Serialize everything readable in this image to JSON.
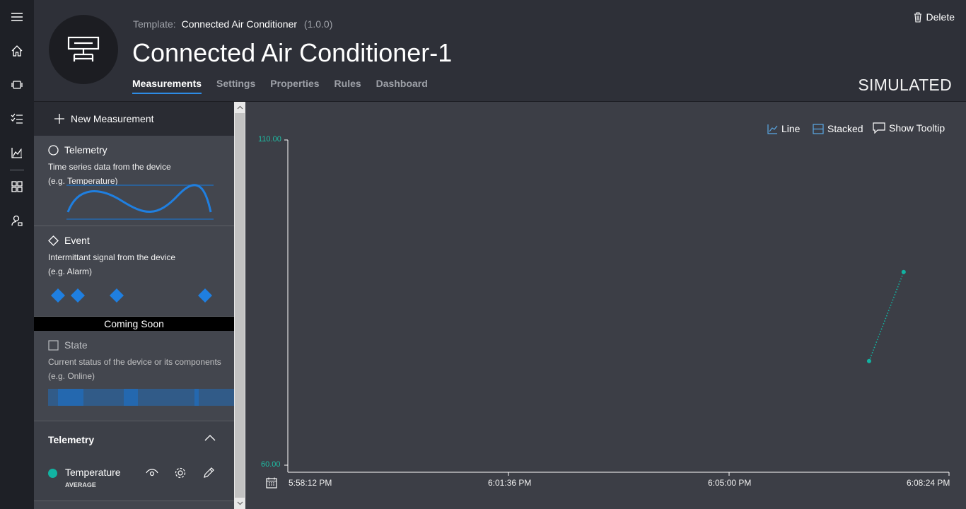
{
  "header": {
    "template_label": "Template:",
    "template_name": "Connected Air Conditioner",
    "template_version": "(1.0.0)",
    "device_title": "Connected Air Conditioner-1",
    "delete_label": "Delete",
    "status": "SIMULATED",
    "tabs": [
      {
        "label": "Measurements",
        "active": true
      },
      {
        "label": "Settings"
      },
      {
        "label": "Properties"
      },
      {
        "label": "Rules"
      },
      {
        "label": "Dashboard"
      }
    ]
  },
  "rail": {
    "icons": [
      "menu-icon",
      "home-icon",
      "devices-icon",
      "tasks-icon",
      "analytics-icon",
      "dashboard-icon",
      "user-icon"
    ]
  },
  "left_panel": {
    "new_measurement_label": "New Measurement",
    "cards": [
      {
        "title": "Telemetry",
        "desc1": "Time series data from the device",
        "desc2": "(e.g. Temperature)"
      },
      {
        "title": "Event",
        "desc1": "Intermittant signal from the device",
        "desc2": "(e.g. Alarm)"
      }
    ],
    "coming_soon": "Coming Soon",
    "state": {
      "title": "State",
      "desc1": "Current status of the device or its components",
      "desc2": "(e.g. Online)"
    },
    "section": {
      "title": "Telemetry",
      "item": {
        "name": "Temperature",
        "aggregation": "AVERAGE",
        "color": "#12b3a2"
      }
    }
  },
  "chart_controls": {
    "line_label": "Line",
    "stacked_label": "Stacked",
    "tooltip_label": "Show Tooltip"
  },
  "chart_data": {
    "type": "line",
    "series": [
      {
        "name": "Temperature",
        "color": "#12b3a2",
        "x": [
          "6:07:10 PM",
          "6:07:42 PM"
        ],
        "y": [
          76.0,
          89.7
        ]
      }
    ],
    "ylim": [
      60,
      110
    ],
    "y_tick_labels": [
      "110.00",
      "60.00"
    ],
    "x_tick_labels": [
      "5:58:12 PM",
      "6:01:36 PM",
      "6:05:00 PM",
      "6:08:24 PM"
    ],
    "grid": false
  }
}
